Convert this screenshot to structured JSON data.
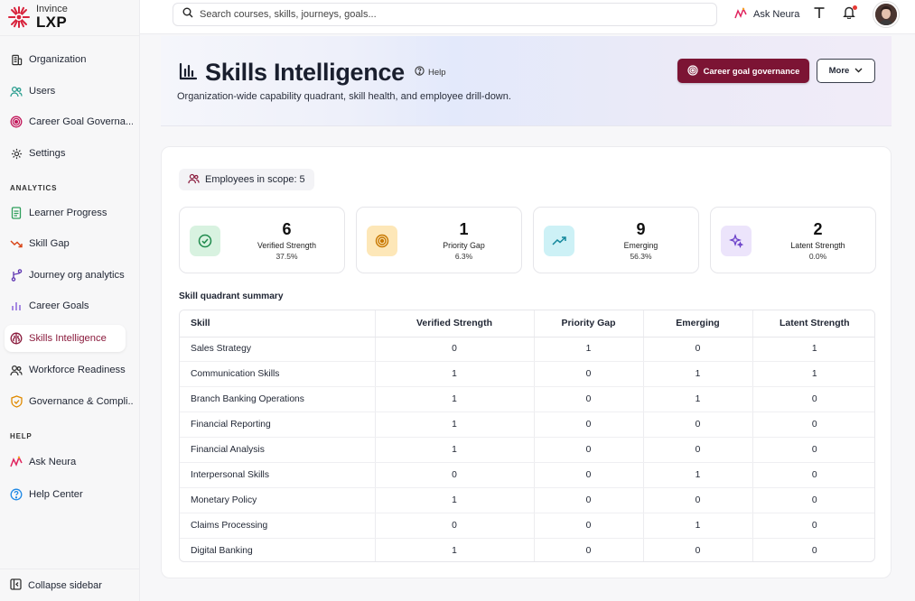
{
  "brand": {
    "line1": "Invince",
    "line2": "LXP"
  },
  "sidebar": {
    "items": [
      {
        "label": "Organization"
      },
      {
        "label": "Users"
      },
      {
        "label": "Career Goal Governa..."
      },
      {
        "label": "Settings"
      }
    ],
    "analytics_heading": "ANALYTICS",
    "analytics_items": [
      {
        "label": "Learner Progress"
      },
      {
        "label": "Skill Gap"
      },
      {
        "label": "Journey org analytics"
      },
      {
        "label": "Career Goals"
      },
      {
        "label": "Skills Intelligence"
      },
      {
        "label": "Workforce Readiness"
      },
      {
        "label": "Governance & Compli..."
      }
    ],
    "help_heading": "HELP",
    "help_items": [
      {
        "label": "Ask Neura"
      },
      {
        "label": "Help Center"
      }
    ],
    "collapse_label": "Collapse sidebar"
  },
  "topbar": {
    "search_placeholder": "Search courses, skills, journeys, goals...",
    "ask_neura": "Ask Neura"
  },
  "header": {
    "title": "Skills Intelligence",
    "help": "Help",
    "subtitle": "Organization-wide capability quadrant, skill health, and employee drill-down.",
    "primary_button": "Career goal governance",
    "more_button": "More"
  },
  "scope": {
    "label": "Employees in scope: 5"
  },
  "stats": [
    {
      "value": "6",
      "label": "Verified Strength",
      "pct": "37.5%",
      "color": "#2e9e5b"
    },
    {
      "value": "1",
      "label": "Priority Gap",
      "pct": "6.3%",
      "color": "#d98a06"
    },
    {
      "value": "9",
      "label": "Emerging",
      "pct": "56.3%",
      "color": "#1a9bb0"
    },
    {
      "value": "2",
      "label": "Latent Strength",
      "pct": "0.0%",
      "color": "#7b4fd6"
    }
  ],
  "quadrant": {
    "title": "Skill quadrant summary",
    "columns": [
      "Skill",
      "Verified Strength",
      "Priority Gap",
      "Emerging",
      "Latent Strength"
    ],
    "rows": [
      [
        "Sales Strategy",
        "0",
        "1",
        "0",
        "1"
      ],
      [
        "Communication Skills",
        "1",
        "0",
        "1",
        "1"
      ],
      [
        "Branch Banking Operations",
        "1",
        "0",
        "1",
        "0"
      ],
      [
        "Financial Reporting",
        "1",
        "0",
        "0",
        "0"
      ],
      [
        "Financial Analysis",
        "1",
        "0",
        "0",
        "0"
      ],
      [
        "Interpersonal Skills",
        "0",
        "0",
        "1",
        "0"
      ],
      [
        "Monetary Policy",
        "1",
        "0",
        "0",
        "0"
      ],
      [
        "Claims Processing",
        "0",
        "0",
        "1",
        "0"
      ],
      [
        "Digital Banking",
        "1",
        "0",
        "0",
        "0"
      ]
    ]
  }
}
